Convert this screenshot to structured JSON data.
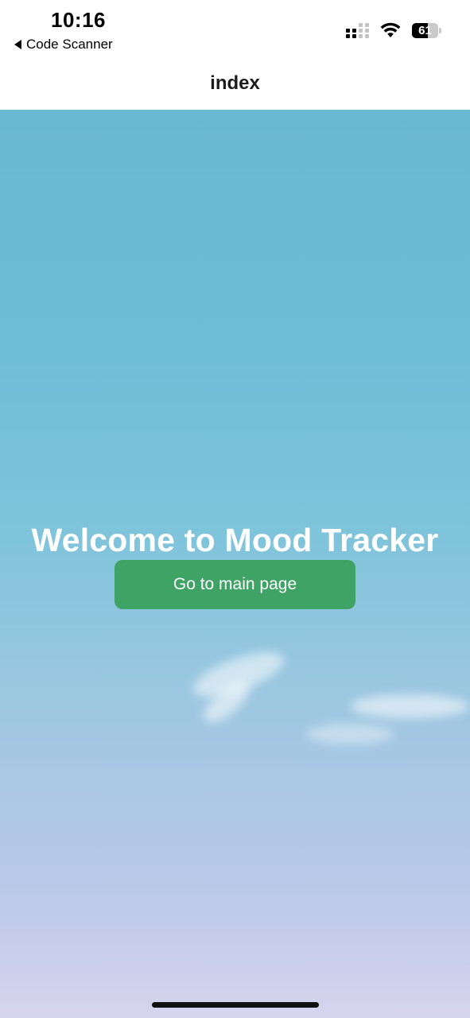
{
  "status_bar": {
    "time": "10:16",
    "back_app_label": "Code Scanner",
    "battery_level": "61",
    "battery_fraction": 0.61,
    "icons": [
      "back-triangle-icon",
      "cellular-signal-icon",
      "wifi-icon",
      "battery-icon"
    ]
  },
  "nav": {
    "title": "index"
  },
  "main": {
    "welcome_text": "Welcome to Mood Tracker",
    "button_label": "Go to main page"
  },
  "colors": {
    "accent_button": "#3fa366",
    "sky_top": "#69b8d1",
    "sky_bottom": "#d7d4ee"
  }
}
